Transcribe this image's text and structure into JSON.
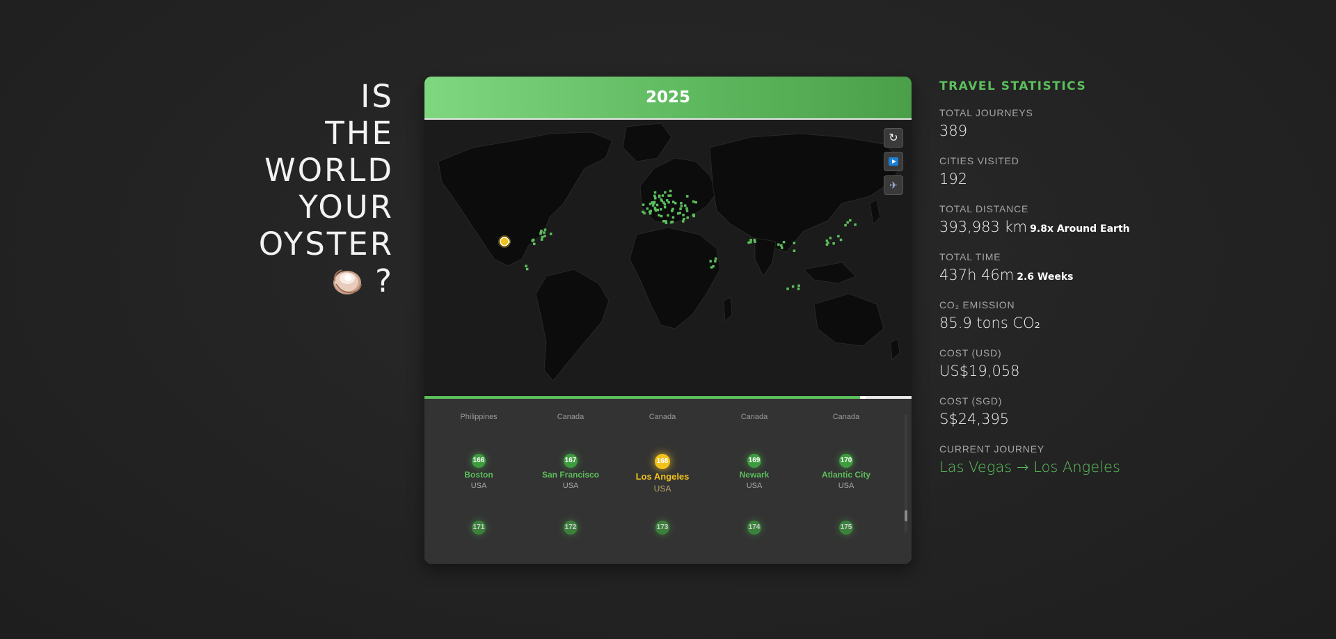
{
  "headline": {
    "lines": [
      "IS",
      "THE",
      "WORLD",
      "YOUR",
      "OYSTER"
    ],
    "suffix": "?",
    "emoji_icon": "oyster-icon"
  },
  "card": {
    "year": "2025",
    "controls": [
      {
        "name": "refresh-button",
        "icon": "refresh-icon",
        "glyph": "↻"
      },
      {
        "name": "play-button",
        "icon": "play-icon"
      },
      {
        "name": "flight-button",
        "icon": "airplane-icon",
        "glyph": "✈"
      }
    ],
    "progress": 0.9,
    "map": {
      "current_marker": "Las Vegas → Los Angeles",
      "accent": "#5cbf5c",
      "active_color": "#f2c21b"
    },
    "timeline": {
      "row1": [
        {
          "country_above": "Philippines",
          "num": "166",
          "city": "Boston",
          "country": "USA",
          "active": false
        },
        {
          "country_above": "Canada",
          "num": "167",
          "city": "San Francisco",
          "country": "USA",
          "active": false
        },
        {
          "country_above": "Canada",
          "num": "168",
          "city": "Los Angeles",
          "country": "USA",
          "active": true
        },
        {
          "country_above": "Canada",
          "num": "169",
          "city": "Newark",
          "country": "USA",
          "active": false
        },
        {
          "country_above": "Canada",
          "num": "170",
          "city": "Atlantic City",
          "country": "USA",
          "active": false
        }
      ],
      "row2": [
        {
          "num": "171"
        },
        {
          "num": "172"
        },
        {
          "num": "173"
        },
        {
          "num": "174"
        },
        {
          "num": "175"
        }
      ]
    }
  },
  "stats": {
    "title": "TRAVEL STATISTICS",
    "items": [
      {
        "label": "TOTAL JOURNEYS",
        "value": "389",
        "extra": ""
      },
      {
        "label": "CITIES VISITED",
        "value": "192",
        "extra": ""
      },
      {
        "label": "TOTAL DISTANCE",
        "value": "393,983 km",
        "extra": "9.8x Around Earth"
      },
      {
        "label": "TOTAL TIME",
        "value": "437h 46m",
        "extra": "2.6 Weeks"
      },
      {
        "label": "CO₂ EMISSION",
        "value": "85.9 tons CO₂",
        "extra": ""
      },
      {
        "label": "COST (USD)",
        "value": "US$19,058",
        "extra": ""
      },
      {
        "label": "COST (SGD)",
        "value": "S$24,395",
        "extra": ""
      },
      {
        "label": "CURRENT JOURNEY",
        "value": "Las Vegas → Los Angeles",
        "extra": ""
      }
    ]
  }
}
